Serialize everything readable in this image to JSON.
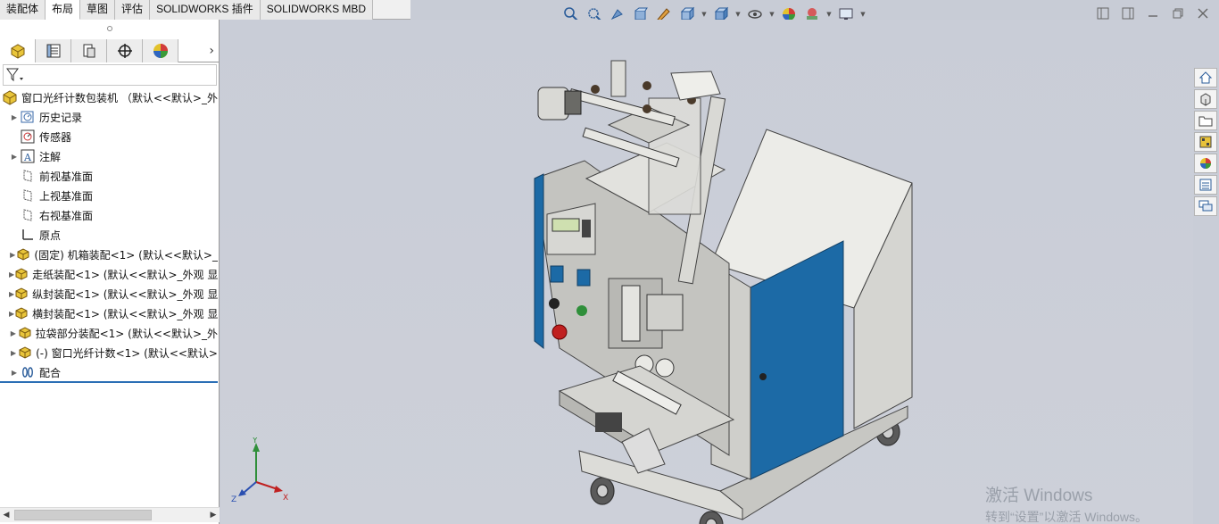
{
  "command_tabs": [
    {
      "label": "装配体",
      "active": false
    },
    {
      "label": "布局",
      "active": true
    },
    {
      "label": "草图",
      "active": false
    },
    {
      "label": "评估",
      "active": false
    },
    {
      "label": "SOLIDWORKS 插件",
      "active": false
    },
    {
      "label": "SOLIDWORKS MBD",
      "active": false
    }
  ],
  "heads_up_toolbar": [
    "zoom-to-fit-icon",
    "zoom-to-area-icon",
    "previous-view-icon",
    "section-view-icon",
    "dynamic-annotation-icon",
    "view-orientation-icon",
    "display-style-icon",
    "hide-show-icon",
    "edit-appearance-icon",
    "apply-scene-icon",
    "view-settings-icon"
  ],
  "manager_tabs": [
    "feature-manager-icon",
    "property-manager-icon",
    "configuration-manager-icon",
    "dimxpert-manager-icon",
    "display-manager-icon"
  ],
  "tree": {
    "root": "窗口光纤计数包装机 （默认<<默认>_外观",
    "items": [
      {
        "label": "历史记录",
        "icon": "history-icon",
        "expandable": true
      },
      {
        "label": "传感器",
        "icon": "sensor-icon",
        "expandable": false
      },
      {
        "label": "注解",
        "icon": "annotation-icon",
        "expandable": true
      },
      {
        "label": "前视基准面",
        "icon": "plane-icon",
        "expandable": false
      },
      {
        "label": "上视基准面",
        "icon": "plane-icon",
        "expandable": false
      },
      {
        "label": "右视基准面",
        "icon": "plane-icon",
        "expandable": false
      },
      {
        "label": "原点",
        "icon": "origin-icon",
        "expandable": false
      },
      {
        "label": "(固定) 机箱装配<1> (默认<<默认>_",
        "icon": "assembly-icon",
        "expandable": true
      },
      {
        "label": "走纸装配<1> (默认<<默认>_外观 显",
        "icon": "assembly-icon",
        "expandable": true
      },
      {
        "label": "纵封装配<1> (默认<<默认>_外观 显",
        "icon": "assembly-icon",
        "expandable": true
      },
      {
        "label": "横封装配<1> (默认<<默认>_外观 显",
        "icon": "assembly-icon",
        "expandable": true
      },
      {
        "label": "拉袋部分装配<1> (默认<<默认>_外",
        "icon": "assembly-icon",
        "expandable": true
      },
      {
        "label": "(-) 窗口光纤计数<1> (默认<<默认>",
        "icon": "assembly-icon",
        "expandable": true
      },
      {
        "label": "配合",
        "icon": "mates-icon",
        "expandable": true
      }
    ]
  },
  "triad": {
    "x": "X",
    "y": "Y",
    "z": "Z"
  },
  "watermark": {
    "line1": "激活 Windows",
    "line2": "转到“设置”以激活 Windows。"
  },
  "task_pane": [
    "home-icon",
    "design-library-icon",
    "file-explorer-icon",
    "view-palette-icon",
    "appearances-icon",
    "custom-properties-icon",
    "forum-icon"
  ],
  "colors": {
    "accent_blue": "#1f6aa8",
    "machine_grey": "#d9d9d6",
    "panel_blue": "#1c6aa6",
    "viewport_bg": "#c9cdd7"
  }
}
